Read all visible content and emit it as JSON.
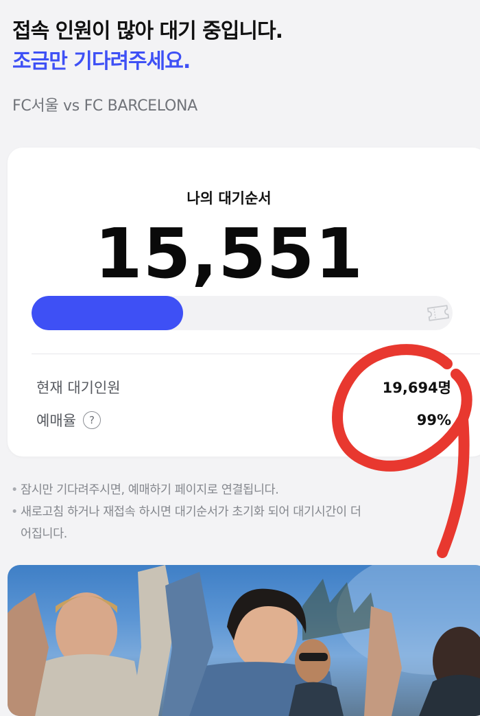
{
  "header": {
    "title_line1": "접속 인원이 많아 대기 중입니다.",
    "title_line2": "조금만 기다려주세요.",
    "match": "FC서울 vs FC BARCELONA"
  },
  "queue": {
    "label": "나의 대기순서",
    "number": "15,551",
    "progress_fraction": 0.36
  },
  "stats": {
    "waiting_label": "현재 대기인원",
    "waiting_value": "19,694명",
    "rate_label": "예매율",
    "rate_value": "99%",
    "help_glyph": "?"
  },
  "notices": {
    "line1": "잠시만 기다려주시면, 예매하기 페이지로 연결됩니다.",
    "line2a": "새로고침 하거나 재접속 하시면 대기순서가 초기화 되어 대기시간이 더",
    "line2b": "어집니다."
  },
  "icons": {
    "ticket": "ticket-icon",
    "help": "help-icon",
    "bullet": "•"
  },
  "colors": {
    "accent": "#3e50f5",
    "annotation": "#e8382f"
  }
}
